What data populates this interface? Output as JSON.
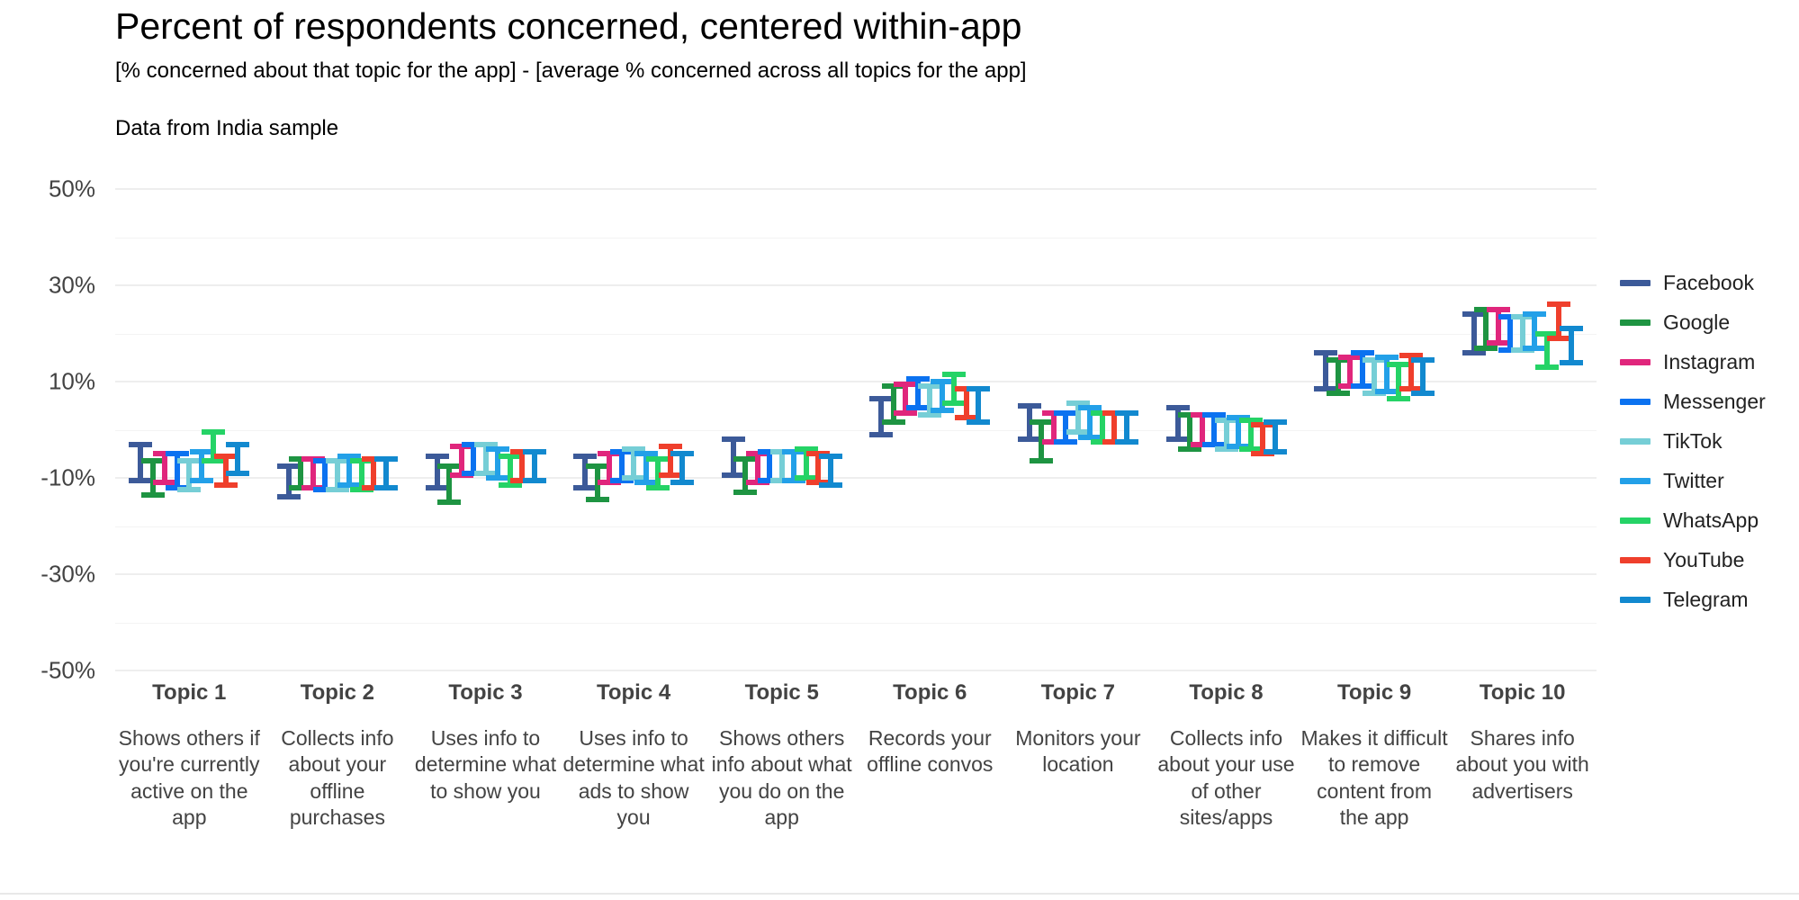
{
  "header": {
    "title": "Percent of respondents concerned, centered within-app",
    "subtitle": "[% concerned about that topic for the app] - [average % concerned across all topics for the app]",
    "note": "Data from India sample"
  },
  "legend": {
    "position": "right",
    "items": [
      {
        "label": "Facebook",
        "color": "#3c5a99"
      },
      {
        "label": "Google",
        "color": "#1e9442"
      },
      {
        "label": "Instagram",
        "color": "#e0267c"
      },
      {
        "label": "Messenger",
        "color": "#0b72f0"
      },
      {
        "label": "TikTok",
        "color": "#76ced6"
      },
      {
        "label": "Twitter",
        "color": "#23a0e8"
      },
      {
        "label": "WhatsApp",
        "color": "#25d366"
      },
      {
        "label": "YouTube",
        "color": "#ef3f2c"
      },
      {
        "label": "Telegram",
        "color": "#1289cf"
      }
    ]
  },
  "chart_data": {
    "type": "scatter",
    "title": "Percent of respondents concerned, centered within-app",
    "subtitle": "[% concerned about that topic for the app] - [average % concerned across all topics for the app]",
    "annotation": "Data from India sample",
    "xlabel": "",
    "ylabel": "",
    "ylim": [
      -50,
      50
    ],
    "yticks": [
      50,
      30,
      10,
      -10,
      -30,
      -50
    ],
    "ytick_labels": [
      "50%",
      "30%",
      "10%",
      "-10%",
      "-30%",
      "-50%"
    ],
    "minor_yticks": [
      40,
      20,
      0,
      -20,
      -40
    ],
    "grid": true,
    "error_bars": "95% confidence interval",
    "categories": [
      {
        "name": "Topic 1",
        "desc": "Shows others if you're currently active on the app"
      },
      {
        "name": "Topic 2",
        "desc": "Collects info about your offline purchases"
      },
      {
        "name": "Topic 3",
        "desc": "Uses info to determine what to show you"
      },
      {
        "name": "Topic 4",
        "desc": "Uses info to determine what ads to show you"
      },
      {
        "name": "Topic 5",
        "desc": "Shows others info about what you do on the app"
      },
      {
        "name": "Topic 6",
        "desc": "Records your offline convos"
      },
      {
        "name": "Topic 7",
        "desc": "Monitors your location"
      },
      {
        "name": "Topic 8",
        "desc": "Collects info about your use of other sites/apps"
      },
      {
        "name": "Topic 9",
        "desc": "Makes it difficult to remove content from the app"
      },
      {
        "name": "Topic 10",
        "desc": "Shares info about you with advertisers"
      }
    ],
    "series": [
      {
        "name": "Facebook",
        "color": "#3c5a99",
        "values": [
          -6.5,
          -10.5,
          -8.5,
          -8.5,
          -5.5,
          3.0,
          1.5,
          1.5,
          12.5,
          20.0
        ],
        "err_low": [
          -10.5,
          -14.0,
          -12.0,
          -12.0,
          -9.5,
          -1.0,
          -2.0,
          -2.0,
          8.5,
          16.0
        ],
        "err_high": [
          -3.0,
          -7.5,
          -5.5,
          -5.5,
          -2.0,
          6.5,
          5.0,
          4.5,
          16.0,
          24.0
        ]
      },
      {
        "name": "Google",
        "color": "#1e9442",
        "values": [
          -10.0,
          -9.0,
          -11.0,
          -11.0,
          -9.5,
          5.5,
          -2.5,
          -0.5,
          11.0,
          21.0
        ],
        "err_low": [
          -13.5,
          -12.0,
          -15.0,
          -14.5,
          -13.0,
          1.5,
          -6.5,
          -4.0,
          7.5,
          17.0
        ],
        "err_high": [
          -6.5,
          -6.0,
          -7.5,
          -7.5,
          -6.0,
          9.0,
          1.5,
          3.0,
          14.5,
          25.0
        ]
      },
      {
        "name": "Instagram",
        "color": "#e0267c",
        "values": [
          -8.0,
          -9.0,
          -6.5,
          -8.0,
          -8.0,
          6.5,
          0.5,
          0.0,
          12.0,
          21.5
        ],
        "err_low": [
          -11.0,
          -12.0,
          -9.5,
          -11.0,
          -11.0,
          3.5,
          -2.5,
          -3.0,
          9.0,
          18.0
        ],
        "err_high": [
          -5.0,
          -6.0,
          -3.5,
          -5.0,
          -5.0,
          9.5,
          3.5,
          3.0,
          15.0,
          25.0
        ]
      },
      {
        "name": "Messenger",
        "color": "#0b72f0",
        "values": [
          -8.5,
          -9.5,
          -6.0,
          -7.5,
          -7.5,
          7.5,
          0.5,
          0.0,
          12.5,
          20.0
        ],
        "err_low": [
          -12.0,
          -12.5,
          -9.0,
          -10.5,
          -10.5,
          4.5,
          -2.5,
          -3.0,
          9.0,
          16.5
        ],
        "err_high": [
          -5.0,
          -6.5,
          -3.0,
          -4.5,
          -4.5,
          10.5,
          3.5,
          3.0,
          16.0,
          23.5
        ]
      },
      {
        "name": "TikTok",
        "color": "#76ced6",
        "values": [
          -9.5,
          -9.5,
          -6.0,
          -7.0,
          -7.5,
          6.0,
          2.5,
          -1.0,
          11.0,
          20.0
        ],
        "err_low": [
          -12.5,
          -12.5,
          -9.0,
          -10.0,
          -10.5,
          3.0,
          -0.5,
          -4.0,
          7.5,
          16.5
        ],
        "err_high": [
          -6.5,
          -6.5,
          -3.0,
          -4.0,
          -4.5,
          9.0,
          5.5,
          2.0,
          14.5,
          23.5
        ]
      },
      {
        "name": "Twitter",
        "color": "#23a0e8",
        "values": [
          -7.5,
          -8.5,
          -7.0,
          -8.0,
          -7.5,
          7.0,
          1.5,
          -0.5,
          11.5,
          20.5
        ],
        "err_low": [
          -10.5,
          -11.5,
          -10.0,
          -11.0,
          -10.5,
          4.0,
          -1.5,
          -3.5,
          8.0,
          17.0
        ],
        "err_high": [
          -4.5,
          -5.5,
          -4.0,
          -5.0,
          -4.5,
          10.0,
          4.5,
          2.5,
          15.0,
          24.0
        ]
      },
      {
        "name": "WhatsApp",
        "color": "#25d366",
        "values": [
          -3.5,
          -9.5,
          -8.5,
          -9.0,
          -7.0,
          8.5,
          0.5,
          -1.0,
          10.0,
          16.5
        ],
        "err_low": [
          -6.5,
          -12.5,
          -11.5,
          -12.0,
          -10.0,
          5.5,
          -2.5,
          -4.0,
          6.5,
          13.0
        ],
        "err_high": [
          -0.5,
          -6.5,
          -5.5,
          -6.0,
          -4.0,
          11.5,
          3.5,
          2.0,
          13.5,
          20.0
        ]
      },
      {
        "name": "YouTube",
        "color": "#ef3f2c",
        "values": [
          -8.5,
          -9.0,
          -7.5,
          -6.5,
          -8.0,
          5.5,
          0.5,
          -2.0,
          12.0,
          22.5
        ],
        "err_low": [
          -11.5,
          -12.0,
          -10.5,
          -9.5,
          -11.0,
          2.5,
          -2.5,
          -5.0,
          8.5,
          19.0
        ],
        "err_high": [
          -5.5,
          -6.0,
          -4.5,
          -3.5,
          -5.0,
          8.5,
          3.5,
          1.0,
          15.5,
          26.0
        ]
      },
      {
        "name": "Telegram",
        "color": "#1289cf",
        "values": [
          -6.0,
          -9.0,
          -7.5,
          -8.0,
          -8.5,
          5.0,
          0.5,
          -1.5,
          11.0,
          17.5
        ],
        "err_low": [
          -9.0,
          -12.0,
          -10.5,
          -11.0,
          -11.5,
          1.5,
          -2.5,
          -4.5,
          7.5,
          14.0
        ],
        "err_high": [
          -3.0,
          -6.0,
          -4.5,
          -5.0,
          -5.5,
          8.5,
          3.5,
          1.5,
          14.5,
          21.0
        ]
      }
    ]
  }
}
